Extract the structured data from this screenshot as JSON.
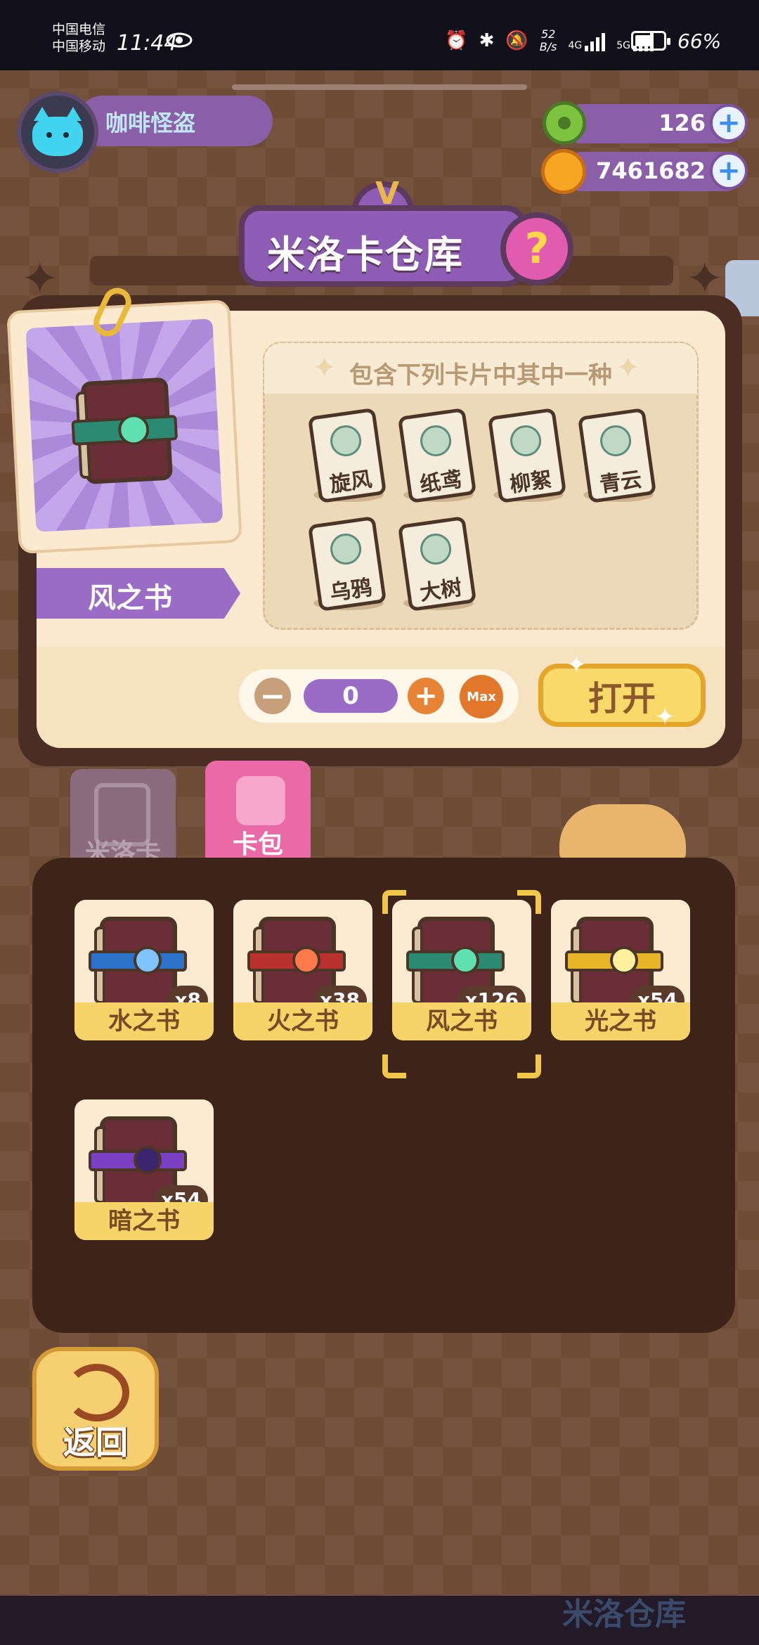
{
  "status_bar": {
    "carrier_1": "中国电信",
    "carrier_2": "中国移动",
    "time": "11:44",
    "net_speed_value": "52",
    "net_speed_unit": "B/s",
    "signal_1": "4G",
    "signal_2": "5G",
    "battery": "66%"
  },
  "player": {
    "name": "咖啡怪盗",
    "avatar": "cat-avatar"
  },
  "currencies": [
    {
      "icon": "green-donut-icon",
      "value": "126"
    },
    {
      "icon": "gold-coin-icon",
      "value": "7461682"
    }
  ],
  "title": {
    "text": "米洛卡仓库",
    "help": "?",
    "mark": "V"
  },
  "selected_book": {
    "name": "风之书"
  },
  "info": {
    "title": "包含下列卡片中其中一种",
    "cards": [
      "旋风",
      "纸鸢",
      "柳絮",
      "青云",
      "乌鸦",
      "大树"
    ]
  },
  "quantity": {
    "minus": "−",
    "value": "0",
    "plus": "+",
    "max": "Max"
  },
  "open_button": "打开",
  "tabs": [
    {
      "label": "米洛卡",
      "active": false
    },
    {
      "label": "卡包",
      "active": true
    }
  ],
  "inventory": [
    {
      "name": "水之书",
      "count": "x8",
      "color": "#2d72c9"
    },
    {
      "name": "火之书",
      "count": "x38",
      "color": "#b8312d"
    },
    {
      "name": "风之书",
      "count": "x126",
      "color": "#2a8a72",
      "selected": true
    },
    {
      "name": "光之书",
      "count": "x54",
      "color": "#e8b52a"
    },
    {
      "name": "暗之书",
      "count": "x54",
      "color": "#7b3fc4"
    }
  ],
  "back_button": "返回",
  "background_text": "米洛仓库"
}
